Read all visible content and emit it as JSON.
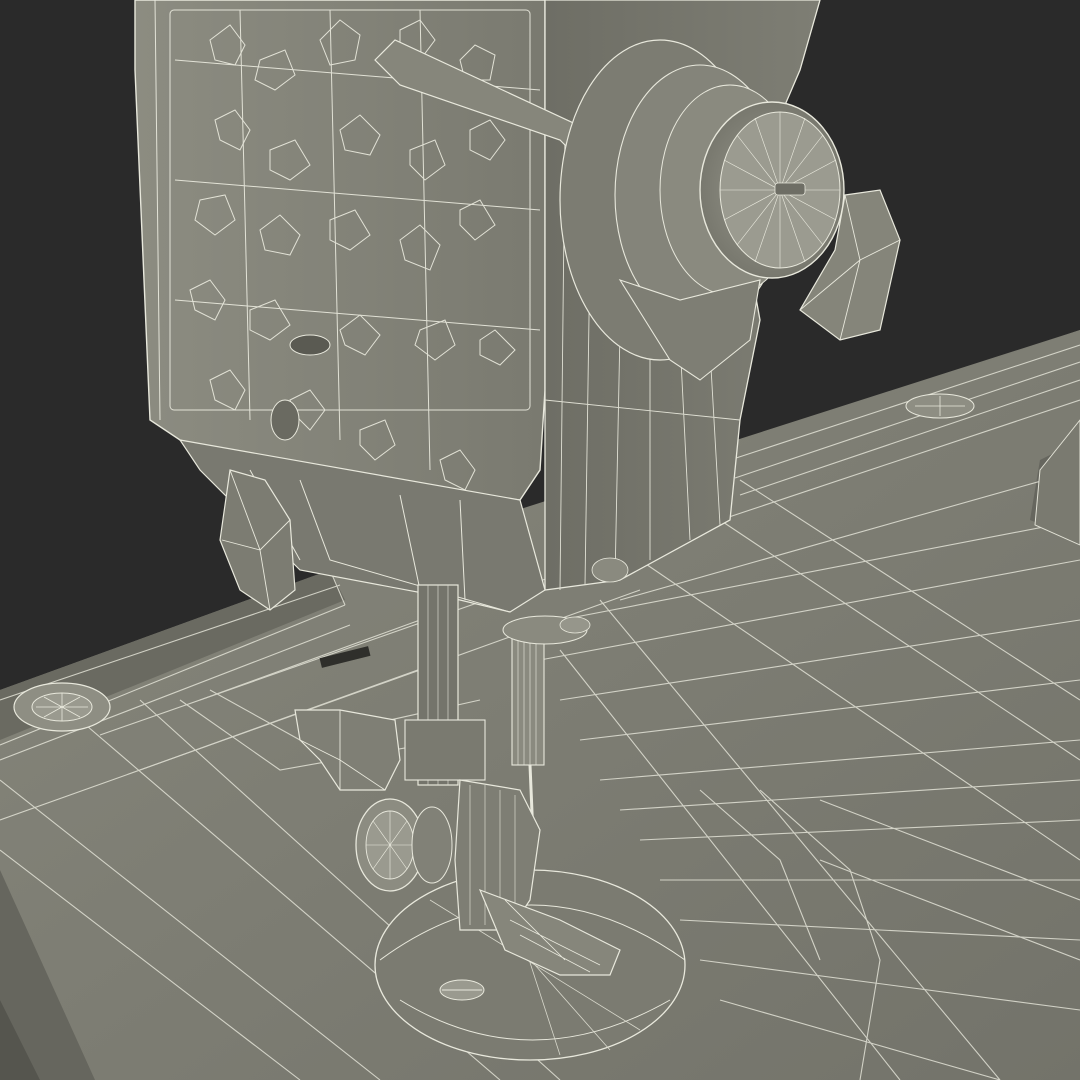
{
  "scene": {
    "subject": "",
    "colors": {
      "background": "#2a2a2a",
      "surface_light": "#8a8a7e",
      "surface_mid": "#75756b",
      "surface_dark": "#5d5d55",
      "wire": "#e8e8dc",
      "wire_dim": "#c9c9bc",
      "shadow": "#3e3e39"
    }
  }
}
